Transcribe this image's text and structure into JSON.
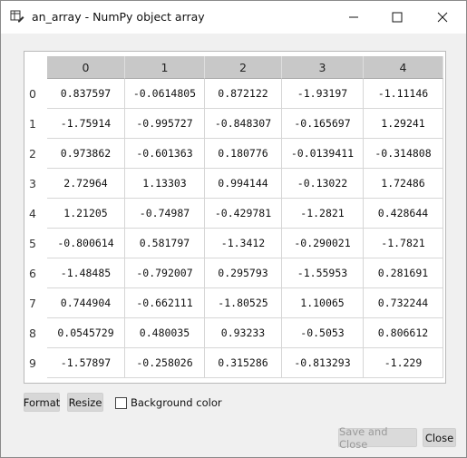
{
  "window": {
    "title": "an_array - NumPy object array",
    "icon": "table-edit-icon"
  },
  "table": {
    "columns": [
      "0",
      "1",
      "2",
      "3",
      "4"
    ],
    "rows": [
      "0",
      "1",
      "2",
      "3",
      "4",
      "5",
      "6",
      "7",
      "8",
      "9"
    ],
    "cells": [
      [
        "0.837597",
        "-0.0614805",
        "0.872122",
        "-1.93197",
        "-1.11146"
      ],
      [
        "-1.75914",
        "-0.995727",
        "-0.848307",
        "-0.165697",
        "1.29241"
      ],
      [
        "0.973862",
        "-0.601363",
        "0.180776",
        "-0.0139411",
        "-0.314808"
      ],
      [
        "2.72964",
        "1.13303",
        "0.994144",
        "-0.13022",
        "1.72486"
      ],
      [
        "1.21205",
        "-0.74987",
        "-0.429781",
        "-1.2821",
        "0.428644"
      ],
      [
        "-0.800614",
        "0.581797",
        "-1.3412",
        "-0.290021",
        "-1.7821"
      ],
      [
        "-1.48485",
        "-0.792007",
        "0.295793",
        "-1.55953",
        "0.281691"
      ],
      [
        "0.744904",
        "-0.662111",
        "-1.80525",
        "1.10065",
        "0.732244"
      ],
      [
        "0.0545729",
        "0.480035",
        "0.93233",
        "-0.5053",
        "0.806612"
      ],
      [
        "-1.57897",
        "-0.258026",
        "0.315286",
        "-0.813293",
        "-1.229"
      ]
    ]
  },
  "toolbar": {
    "format_label": "Format",
    "resize_label": "Resize",
    "background_label": "Background color",
    "background_checked": false
  },
  "footer": {
    "save_close_label": "Save and Close",
    "close_label": "Close"
  },
  "colors": {
    "header_bg": "#c8c8c8",
    "window_bg": "#f0f0f0",
    "button_bg": "#d7d7d7"
  }
}
